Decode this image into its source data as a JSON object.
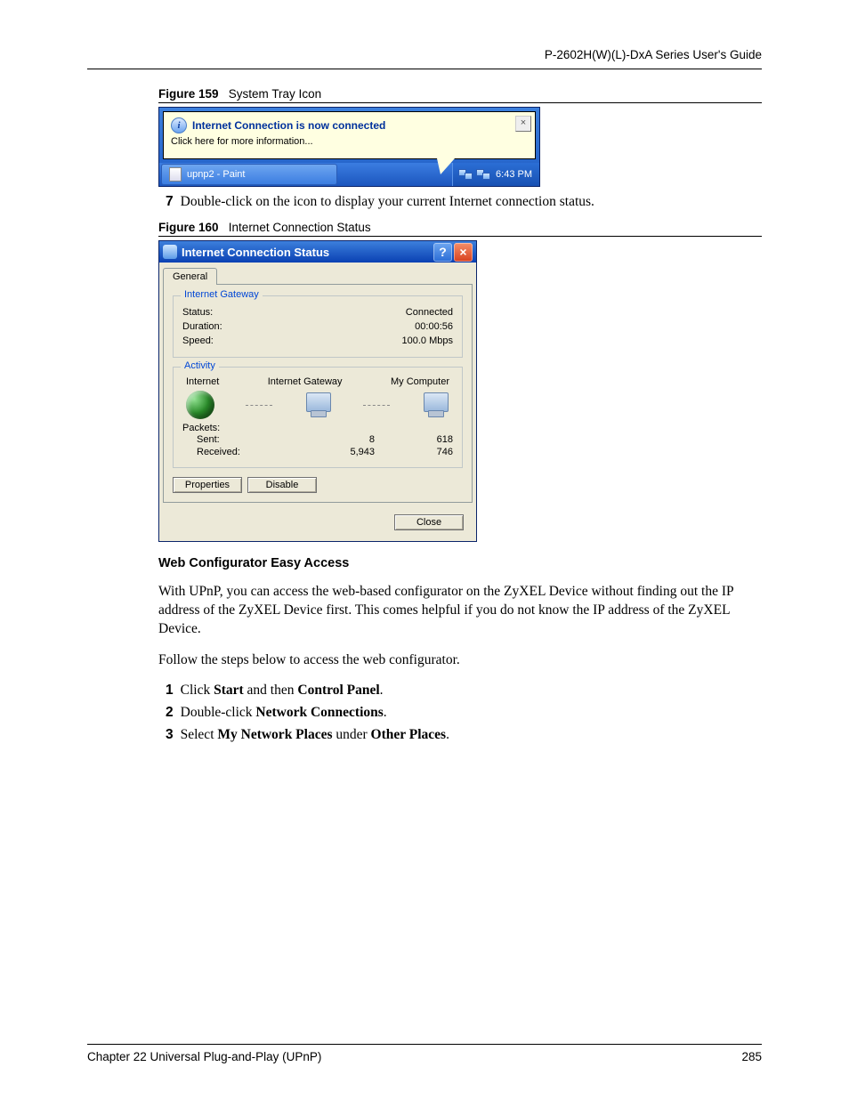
{
  "header": {
    "guide_title": "P-2602H(W)(L)-DxA Series User's Guide"
  },
  "fig159": {
    "caption_label": "Figure 159",
    "caption_text": "System Tray Icon",
    "balloon_title": "Internet Connection is now connected",
    "balloon_sub": "Click here for more information...",
    "task_button": "upnp2 - Paint",
    "clock": "6:43 PM"
  },
  "step7": {
    "num": "7",
    "text": "Double-click on the icon to display your current Internet connection status."
  },
  "fig160": {
    "caption_label": "Figure 160",
    "caption_text": "Internet Connection Status",
    "title": "Internet Connection Status",
    "tab": "General",
    "group1": {
      "legend": "Internet Gateway",
      "status_label": "Status:",
      "status_value": "Connected",
      "duration_label": "Duration:",
      "duration_value": "00:00:56",
      "speed_label": "Speed:",
      "speed_value": "100.0 Mbps"
    },
    "group2": {
      "legend": "Activity",
      "col_internet": "Internet",
      "col_gateway": "Internet Gateway",
      "col_computer": "My Computer",
      "packets_label": "Packets:",
      "sent_label": "Sent:",
      "received_label": "Received:",
      "sent_gw": "8",
      "sent_pc": "618",
      "recv_gw": "5,943",
      "recv_pc": "746"
    },
    "btn_properties": "Properties",
    "btn_disable": "Disable",
    "btn_close": "Close"
  },
  "section": {
    "heading": "Web Configurator Easy Access",
    "para1": "With UPnP, you can access the web-based configurator on the ZyXEL Device without finding out the IP address of the ZyXEL Device first. This comes helpful if you do not know the IP address of the ZyXEL Device.",
    "para2": "Follow the steps below to access the web configurator.",
    "steps": [
      {
        "n": "1",
        "pre": "Click ",
        "b1": "Start",
        "mid": " and then ",
        "b2": "Control Panel",
        "post": "."
      },
      {
        "n": "2",
        "pre": "Double-click ",
        "b1": "Network Connections",
        "mid": "",
        "b2": "",
        "post": "."
      },
      {
        "n": "3",
        "pre": "Select ",
        "b1": "My Network Places",
        "mid": " under ",
        "b2": "Other Places",
        "post": "."
      }
    ]
  },
  "footer": {
    "chapter": "Chapter 22 Universal Plug-and-Play (UPnP)",
    "page": "285"
  }
}
